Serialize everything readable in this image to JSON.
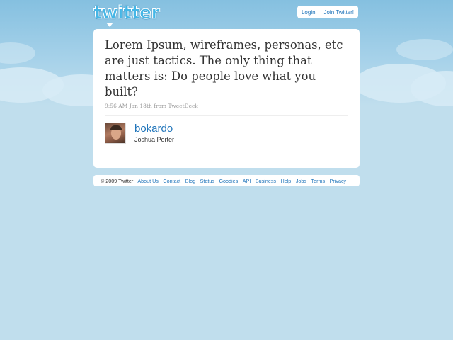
{
  "header": {
    "logo_text": "twitter",
    "login_label": "Login",
    "join_label": "Join Twitter!"
  },
  "tweet": {
    "text": "Lorem Ipsum, wireframes, personas, etc are just tactics. The only thing that matters is: Do people love what you built?",
    "meta": "9:56 AM Jan 18th from TweetDeck"
  },
  "author": {
    "screen_name": "bokardo",
    "full_name": "Joshua Porter"
  },
  "footer": {
    "copyright": "© 2009 Twitter",
    "links": [
      "About Us",
      "Contact",
      "Blog",
      "Status",
      "Goodies",
      "API",
      "Business",
      "Help",
      "Jobs",
      "Terms",
      "Privacy"
    ]
  },
  "colors": {
    "background": "#c0deed",
    "link": "#2276bb",
    "logo": "#45b6e6"
  }
}
